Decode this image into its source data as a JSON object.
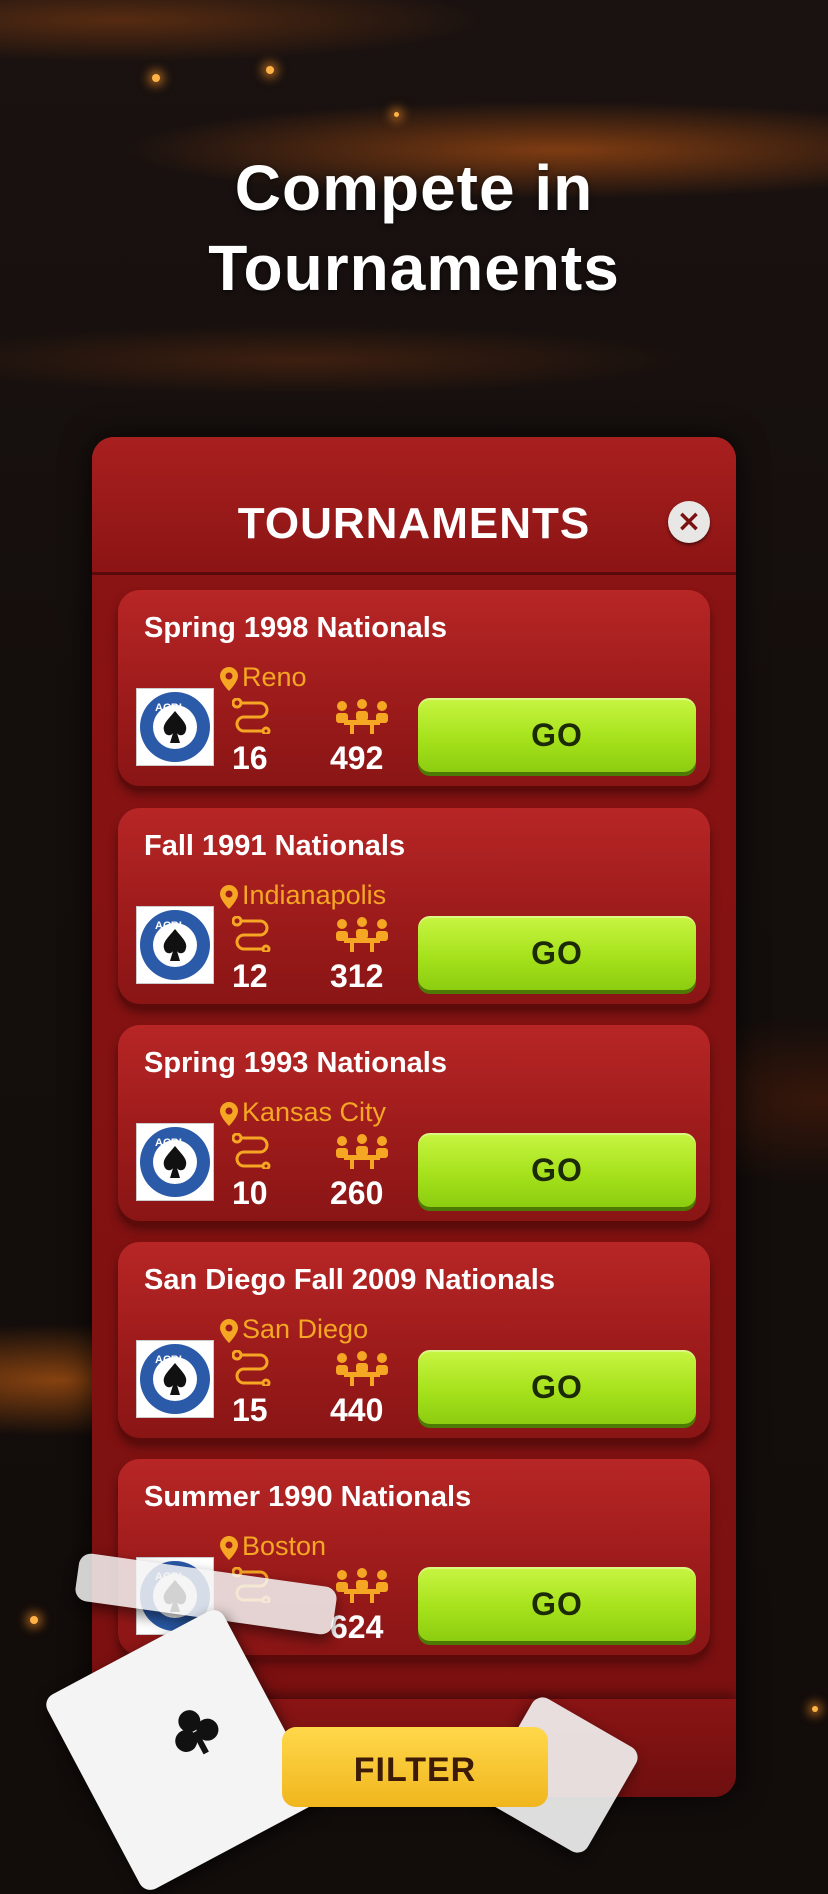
{
  "headline": [
    "Compete in",
    "Tournaments"
  ],
  "panel": {
    "title": "TOURNAMENTS",
    "close_symbol": "×"
  },
  "tournaments": [
    {
      "name": "Spring 1998 Nationals",
      "location": "Reno",
      "events": "16",
      "tables": "492",
      "action": "GO"
    },
    {
      "name": "Fall 1991 Nationals",
      "location": "Indianapolis",
      "events": "12",
      "tables": "312",
      "action": "GO"
    },
    {
      "name": "Spring 1993 Nationals",
      "location": "Kansas City",
      "events": "10",
      "tables": "260",
      "action": "GO"
    },
    {
      "name": "San Diego Fall 2009 Nationals",
      "location": "San Diego",
      "events": "15",
      "tables": "440",
      "action": "GO"
    },
    {
      "name": "Summer 1990 Nationals",
      "location": "Boston",
      "events": "",
      "tables": "624",
      "action": "GO"
    }
  ],
  "logo_text": "ACBL",
  "filter_label": "FILTER",
  "colors": {
    "accent_location": "#f5a623",
    "go_button": "#a6e21c",
    "panel_red": "#8a1313",
    "filter_button": "#f0b61e"
  },
  "icons": [
    "location-pin-icon",
    "route-icon",
    "tables-players-icon",
    "close-icon",
    "spade-icon"
  ]
}
